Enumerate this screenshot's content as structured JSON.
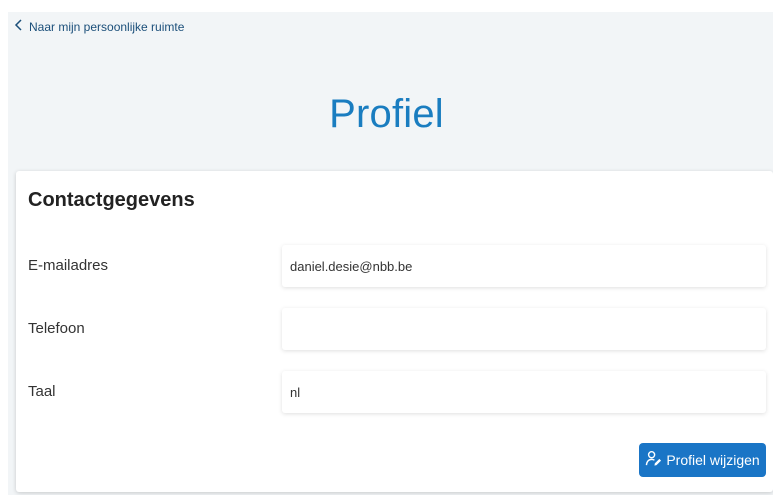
{
  "back_link": {
    "label": "Naar mijn persoonlijke ruimte",
    "icon": "chevron-left-icon"
  },
  "page": {
    "title": "Profiel"
  },
  "contact": {
    "title": "Contactgegevens",
    "fields": [
      {
        "label": "E-mailadres",
        "value": "daniel.desie@nbb.be"
      },
      {
        "label": "Telefoon",
        "value": ""
      },
      {
        "label": "Taal",
        "value": "nl"
      }
    ],
    "edit_button": {
      "label": "Profiel wijzigen",
      "icon": "user-edit-icon"
    }
  },
  "colors": {
    "accent": "#1a7dc0",
    "button": "#1a75c6",
    "page_bg": "#f2f5f7"
  }
}
